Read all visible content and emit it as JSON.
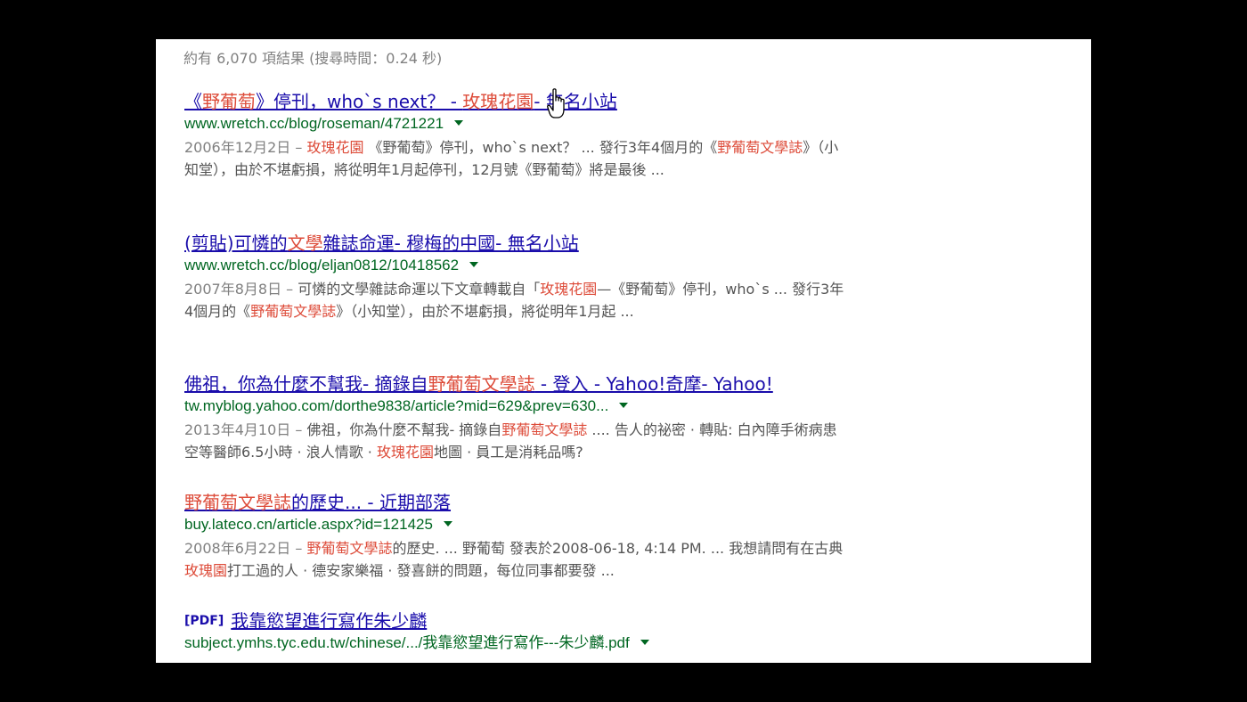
{
  "stats": "約有 6,070 項結果 (搜尋時間：0.24 秒)",
  "results": [
    {
      "title": [
        {
          "t": "《"
        },
        {
          "t": "野葡萄",
          "h": true
        },
        {
          "t": "》停刊，who`s next？ - "
        },
        {
          "t": "玫瑰花園",
          "h": true
        },
        {
          "t": "- 無名小站"
        }
      ],
      "url": "www.wretch.cc/blog/roseman/4721221",
      "date": "2006年12月2日 – ",
      "snippet": [
        {
          "t": "玫瑰花園",
          "h": true
        },
        {
          "t": " 《野葡萄》停刊，who`s next？ ... 發行3年4個月的《"
        },
        {
          "t": "野葡萄文學誌",
          "h": true
        },
        {
          "t": "》（小知堂），由於不堪虧損，將從明年1月起停刊，12月號《野葡萄》將是最後 ..."
        }
      ]
    },
    {
      "title": [
        {
          "t": "(剪貼)可憐的"
        },
        {
          "t": "文學",
          "h": true
        },
        {
          "t": "雜誌命運- 穆梅的中國- 無名小站"
        }
      ],
      "url": "www.wretch.cc/blog/eljan0812/10418562",
      "date": "2007年8月8日 – ",
      "snippet": [
        {
          "t": "可憐的文學雜誌命運以下文章轉載自「"
        },
        {
          "t": "玫瑰花園",
          "h": true
        },
        {
          "t": "—《野葡萄》停刊，who`s ... 發行3年4個月的《"
        },
        {
          "t": "野葡萄文學誌",
          "h": true
        },
        {
          "t": "》（小知堂），由於不堪虧損，將從明年1月起 ..."
        }
      ]
    },
    {
      "title": [
        {
          "t": "佛祖，你為什麼不幫我- 摘錄自"
        },
        {
          "t": "野葡萄文學誌",
          "h": true
        },
        {
          "t": " - 登入 - Yahoo!奇摩- Yahoo!"
        }
      ],
      "url": "tw.myblog.yahoo.com/dorthe9838/article?mid=629&prev=630...",
      "date": "2013年4月10日 – ",
      "snippet": [
        {
          "t": "佛祖，你為什麼不幫我- 摘錄自"
        },
        {
          "t": "野葡萄文學誌",
          "h": true
        },
        {
          "t": " .... 告人的祕密 · 轉貼: 白內障手術病患空等醫師6.5小時 · 浪人情歌 · "
        },
        {
          "t": "玫瑰花園",
          "h": true
        },
        {
          "t": "地圖 · 員工是消耗品嗎?"
        }
      ]
    },
    {
      "title": [
        {
          "t": "野葡萄文學誌",
          "h": true
        },
        {
          "t": "的歷史... - 近期部落"
        }
      ],
      "url": "buy.lateco.cn/article.aspx?id=121425",
      "date": "2008年6月22日 – ",
      "snippet": [
        {
          "t": "野葡萄文學誌",
          "h": true
        },
        {
          "t": "的歷史. ... 野葡萄 發表於2008-06-18, 4:14 PM. ... 我想請問有在古典"
        },
        {
          "t": "玫瑰園",
          "h": true
        },
        {
          "t": "打工過的人 · 德安家樂福 · 發喜餅的問題，每位同事都要發 ..."
        }
      ]
    },
    {
      "tag": "[PDF]",
      "title": [
        {
          "t": "我靠慾望進行寫作朱少麟"
        }
      ],
      "url": "subject.ymhs.tyc.edu.tw/chinese/.../我靠慾望進行寫作---朱少麟.pdf"
    }
  ],
  "colors": {
    "title": "#1a0dab",
    "url": "#006621",
    "highlight": "#dd4b39",
    "snippet": "#545454"
  },
  "icons": {
    "cursor": "hand-pointer-icon",
    "url_menu": "dropdown-arrow-icon"
  }
}
